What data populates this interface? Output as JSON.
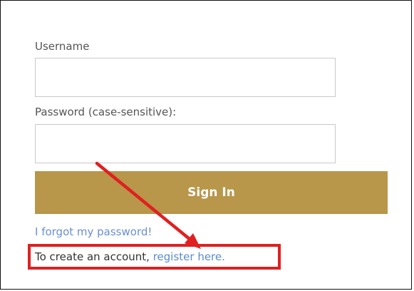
{
  "form": {
    "username_label": "Username",
    "username_value": "",
    "password_label": "Password (case-sensitive):",
    "password_value": "",
    "signin_label": "Sign In",
    "forgot_link": "I forgot my password!",
    "create_prefix": "To create an account, ",
    "register_link": "register here."
  },
  "colors": {
    "signin_button": "#b8964a",
    "link": "#5a8bd0",
    "annotation": "#e02020"
  },
  "annotation": {
    "arrow_icon": "red-arrow-icon",
    "highlight": "red-highlight-box"
  }
}
